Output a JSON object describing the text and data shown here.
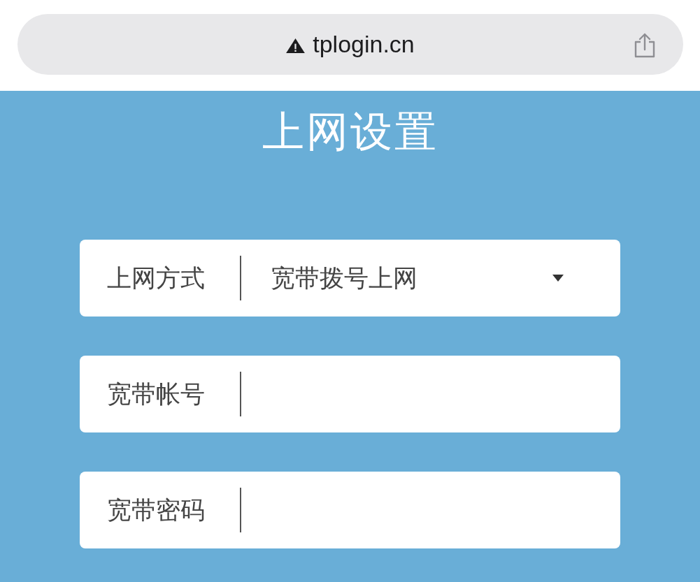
{
  "browser_bar": {
    "url": "tplogin.cn"
  },
  "page": {
    "title": "上网设置"
  },
  "fields": [
    {
      "kind": "select",
      "label": "上网方式",
      "value": "宽带拨号上网"
    },
    {
      "kind": "input",
      "label": "宽带帐号"
    },
    {
      "kind": "input",
      "label": "宽带密码"
    }
  ]
}
